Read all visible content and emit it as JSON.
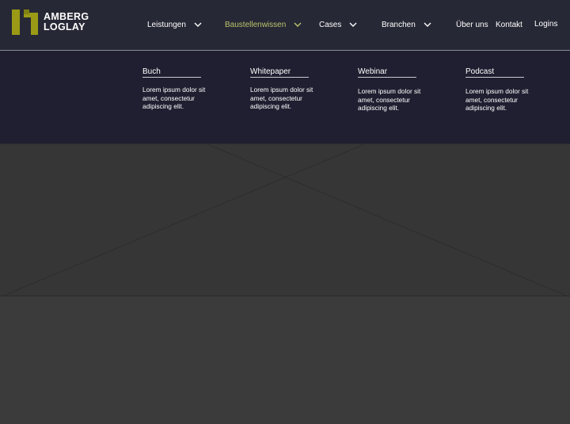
{
  "brand": {
    "logo_line1": "AMBERG",
    "logo_line2": "LOGLAY",
    "logo_icon": "amberg-loglay-logo-icon",
    "accent_color": "#9a9a16"
  },
  "nav": {
    "items": [
      {
        "label": "Leistungen",
        "has_dropdown": true,
        "active": false
      },
      {
        "label": "Baustellenwissen",
        "has_dropdown": true,
        "active": true
      },
      {
        "label": "Cases",
        "has_dropdown": true,
        "active": false
      },
      {
        "label": "Branchen",
        "has_dropdown": true,
        "active": false
      },
      {
        "label": "Über uns",
        "has_dropdown": false,
        "active": false
      },
      {
        "label": "Kontakt",
        "has_dropdown": false,
        "active": false
      },
      {
        "label": "Logins",
        "has_dropdown": false,
        "active": false
      }
    ],
    "active_color": "#b9c46c"
  },
  "megamenu": {
    "columns": [
      {
        "title": "Buch",
        "text": "Lorem ipsum dolor sit amet, consectetur adipiscing elit."
      },
      {
        "title": "Whitepaper",
        "text": "Lorem ipsum dolor sit amet, consectetur adipiscing elit."
      },
      {
        "title": "Webinar",
        "text": "Lorem ipsum dolor sit amet, consectetur adipiscing elit."
      },
      {
        "title": "Podcast",
        "text": "Lorem ipsum dolor sit amet, consectetur adipiscing elit."
      }
    ]
  },
  "hero": {
    "type": "image-placeholder"
  }
}
